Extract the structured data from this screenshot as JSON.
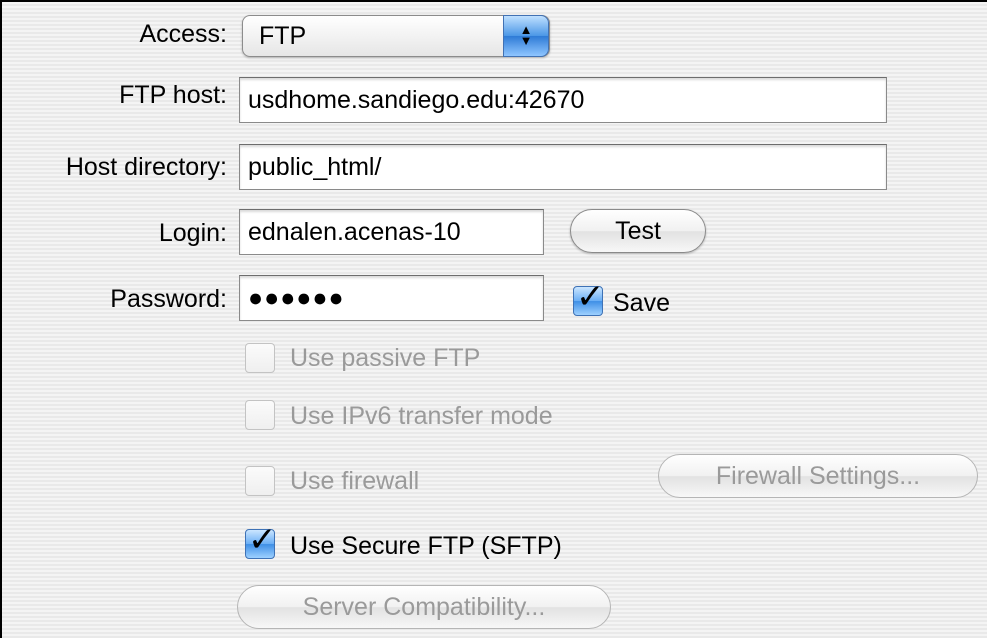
{
  "access": {
    "label": "Access:",
    "value": "FTP"
  },
  "ftp_host": {
    "label": "FTP host:",
    "value": "usdhome.sandiego.edu:42670"
  },
  "host_directory": {
    "label": "Host directory:",
    "value": "public_html/"
  },
  "login": {
    "label": "Login:",
    "value": "ednalen.acenas-10",
    "test_label": "Test"
  },
  "password": {
    "label": "Password:",
    "value": "●●●●●●",
    "save_label": "Save",
    "save_checked": true
  },
  "options": {
    "passive_ftp": "Use passive FTP",
    "ipv6": "Use IPv6 transfer mode",
    "firewall": "Use firewall",
    "firewall_settings": "Firewall Settings...",
    "sftp": "Use Secure FTP (SFTP)",
    "server_compat": "Server Compatibility..."
  },
  "icons": {
    "popup_arrows": "up-down-arrows-icon",
    "check": "checkmark-icon"
  },
  "colors": {
    "accent": "#3f8fe6",
    "disabled_text": "#9a9a9a"
  }
}
